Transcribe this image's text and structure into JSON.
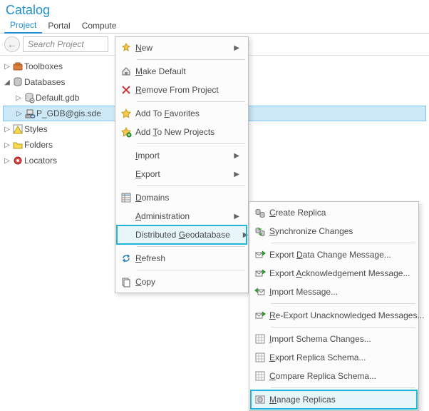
{
  "title": "Catalog",
  "tabs": {
    "project": "Project",
    "portal": "Portal",
    "compute": "Compute"
  },
  "search": {
    "placeholder": "Search Project"
  },
  "tree": {
    "toolboxes": "Toolboxes",
    "databases": "Databases",
    "default_gdb": "Default.gdb",
    "sde": "P_GDB@gis.sde",
    "styles": "Styles",
    "folders": "Folders",
    "locators": "Locators"
  },
  "menu1": {
    "new": "New",
    "make_default": "Make Default",
    "remove": "Remove From Project",
    "add_fav": "Add To Favorites",
    "add_new_proj": "Add To New Projects",
    "import": "Import",
    "export": "Export",
    "domains": "Domains",
    "administration": "Administration",
    "dist_gdb": "Distributed Geodatabase",
    "refresh": "Refresh",
    "copy": "Copy"
  },
  "menu1_access": {
    "new": "N",
    "make_default": "M",
    "remove": "R",
    "add_fav": "F",
    "add_new_proj": "T",
    "import": "I",
    "export": "E",
    "domains": "D",
    "administration": "A",
    "dist_gdb": "G",
    "refresh": "R",
    "copy": "C"
  },
  "menu2": {
    "create_replica": "Create Replica",
    "sync_changes": "Synchronize Changes",
    "export_dcm": "Export Data Change Message...",
    "export_ack": "Export Acknowledgement Message...",
    "import_msg": "Import Message...",
    "reexport": "Re-Export Unacknowledged Messages...",
    "import_schema": "Import Schema Changes...",
    "export_schema": "Export Replica Schema...",
    "compare_schema": "Compare Replica Schema...",
    "manage_replicas": "Manage Replicas"
  },
  "menu2_access": {
    "create_replica": "C",
    "sync_changes": "S",
    "export_dcm": "D",
    "export_ack": "A",
    "import_msg": "I",
    "reexport": "R",
    "import_schema": "I",
    "export_schema": "E",
    "compare_schema": "C",
    "manage_replicas": "M"
  }
}
